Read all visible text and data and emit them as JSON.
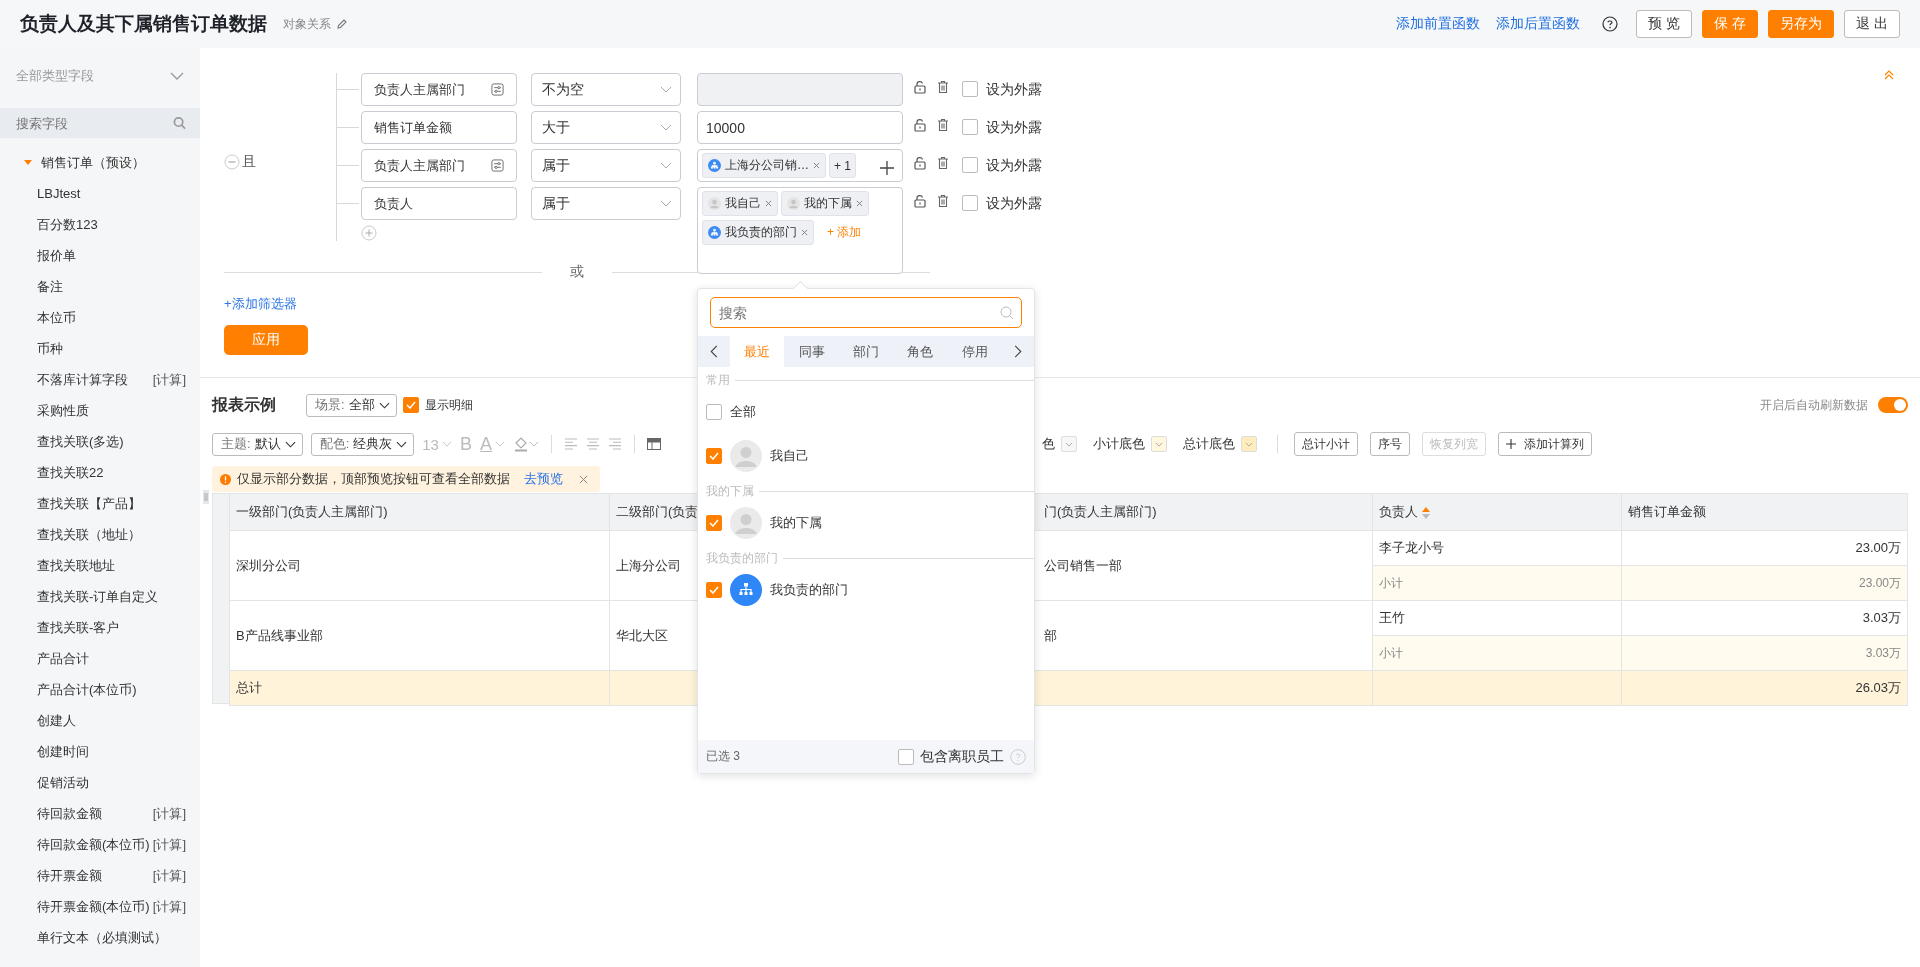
{
  "header": {
    "title": "负责人及其下属销售订单数据",
    "subtitle": "对象关系",
    "links": [
      {
        "label": "添加前置函数"
      },
      {
        "label": "添加后置函数"
      }
    ],
    "buttons": [
      {
        "label": "预 览",
        "kind": "default"
      },
      {
        "label": "保 存",
        "kind": "primary"
      },
      {
        "label": "另存为",
        "kind": "primary"
      },
      {
        "label": "退 出",
        "kind": "default"
      }
    ]
  },
  "sidebar": {
    "type_select": "全部类型字段",
    "search_placeholder": "搜索字段",
    "tree": [
      {
        "label": "销售订单（预设）",
        "expanded": true,
        "children": [
          {
            "label": "LBJtest"
          },
          {
            "label": "百分数123"
          },
          {
            "label": "报价单"
          },
          {
            "label": "备注"
          },
          {
            "label": "本位币"
          },
          {
            "label": "币种"
          },
          {
            "label": "不落库计算字段",
            "tag": "[计算]"
          },
          {
            "label": "采购性质"
          },
          {
            "label": "查找关联(多选)"
          },
          {
            "label": "查找关联22"
          },
          {
            "label": "查找关联【产品】"
          },
          {
            "label": "查找关联（地址）"
          },
          {
            "label": "查找关联地址"
          },
          {
            "label": "查找关联-订单自定义"
          },
          {
            "label": "查找关联-客户"
          },
          {
            "label": "产品合计"
          },
          {
            "label": "产品合计(本位币)"
          },
          {
            "label": "创建人"
          },
          {
            "label": "创建时间"
          },
          {
            "label": "促销活动"
          },
          {
            "label": "待回款金额",
            "tag": "[计算]"
          },
          {
            "label": "待回款金额(本位币)",
            "tag": "[计算]"
          },
          {
            "label": "待开票金额",
            "tag": "[计算]"
          },
          {
            "label": "待开票金额(本位币)",
            "tag": "[计算]"
          },
          {
            "label": "单行文本（必填测试）"
          }
        ]
      }
    ]
  },
  "filters": {
    "logic": "且",
    "rows": [
      {
        "field": "负责人主属部门",
        "has_settings": true,
        "operator": "不为空",
        "value": {
          "kind": "disabled"
        },
        "exposed": false,
        "expose_label": "设为外露"
      },
      {
        "field": "销售订单金额",
        "has_settings": false,
        "operator": "大于",
        "value": {
          "kind": "text",
          "text": "10000"
        },
        "exposed": false,
        "expose_label": "设为外露"
      },
      {
        "field": "负责人主属部门",
        "has_settings": true,
        "operator": "属于",
        "value": {
          "kind": "chips",
          "chips": [
            {
              "kind": "dept",
              "label": "上海分公司销…"
            }
          ],
          "more": "+ 1"
        },
        "exposed": false,
        "expose_label": "设为外露"
      },
      {
        "field": "负责人",
        "has_settings": false,
        "operator": "属于",
        "value": {
          "kind": "chips",
          "chips": [
            {
              "kind": "person",
              "label": "我自己"
            },
            {
              "kind": "person",
              "label": "我的下属"
            },
            {
              "kind": "dept",
              "label": "我负责的部门"
            }
          ],
          "add": "+ 添加"
        },
        "exposed": false,
        "expose_label": "设为外露"
      }
    ],
    "or_label": "或",
    "add_filter": "+添加筛选器",
    "apply": "应用"
  },
  "report": {
    "title": "报表示例",
    "scene": {
      "label": "场景:",
      "value": "全部"
    },
    "show_detail": {
      "label": "显示明细",
      "checked": true
    },
    "auto_refresh": {
      "label": "开启后自动刷新数据",
      "on": true
    },
    "toolbar": {
      "theme": {
        "label": "主题:",
        "value": "默认"
      },
      "palette": {
        "label": "配色:",
        "value": "经典灰"
      },
      "font_size": "13",
      "bold": "B",
      "font_color": "A",
      "colors": [
        {
          "label": "色",
          "color": "#f7f7f7"
        },
        {
          "label": "小计底色",
          "color": "#fff7de"
        },
        {
          "label": "总计底色",
          "color": "#ffedbd"
        }
      ],
      "buttons": [
        {
          "label": "总计小计",
          "kind": "plain",
          "disabled": false
        },
        {
          "label": "序号",
          "kind": "plain",
          "disabled": false
        },
        {
          "label": "恢复列宽",
          "kind": "plain",
          "disabled": true
        },
        {
          "label": "添加计算列",
          "kind": "add",
          "disabled": false
        }
      ]
    },
    "notice": {
      "text": "仅显示部分数据，顶部预览按钮可查看全部数据",
      "link": "去预览"
    },
    "table": {
      "columns": [
        {
          "label": "一级部门(负责人主属部门)"
        },
        {
          "label": "二级部门(负责"
        },
        {
          "label": "门(负责人主属部门)"
        },
        {
          "label": "负责人",
          "sorted": true
        },
        {
          "label": "销售订单金额"
        }
      ],
      "groups": [
        {
          "c1": "深圳分公司",
          "c2": "上海分公司",
          "c3": "公司销售一部",
          "rows": [
            {
              "person": "李子龙小号",
              "amount": "23.00万",
              "subtotal": false
            },
            {
              "person": "小计",
              "amount": "23.00万",
              "subtotal": true
            }
          ]
        },
        {
          "c1": "B产品线事业部",
          "c2": "华北大区",
          "c3": "部",
          "rows": [
            {
              "person": "王竹",
              "amount": "3.03万",
              "subtotal": false
            },
            {
              "person": "小计",
              "amount": "3.03万",
              "subtotal": true
            }
          ]
        }
      ],
      "total": {
        "label": "总计",
        "amount": "26.03万"
      }
    }
  },
  "picker": {
    "search_placeholder": "搜索",
    "tabs": [
      {
        "label": "最近",
        "selected": true
      },
      {
        "label": "同事",
        "selected": false
      },
      {
        "label": "部门",
        "selected": false
      },
      {
        "label": "角色",
        "selected": false
      },
      {
        "label": "停用",
        "selected": false
      }
    ],
    "sections": [
      {
        "title": "常用",
        "items": [
          {
            "label": "全部",
            "checked": false,
            "kind": "all"
          },
          {
            "label": "我自己",
            "checked": true,
            "kind": "person"
          }
        ]
      },
      {
        "title": "我的下属",
        "items": [
          {
            "label": "我的下属",
            "checked": true,
            "kind": "person"
          }
        ]
      },
      {
        "title": "我负责的部门",
        "items": [
          {
            "label": "我负责的部门",
            "checked": true,
            "kind": "dept"
          }
        ]
      }
    ],
    "selected_count": "已选 3",
    "include_resigned": {
      "label": "包含离职员工",
      "checked": false
    }
  }
}
